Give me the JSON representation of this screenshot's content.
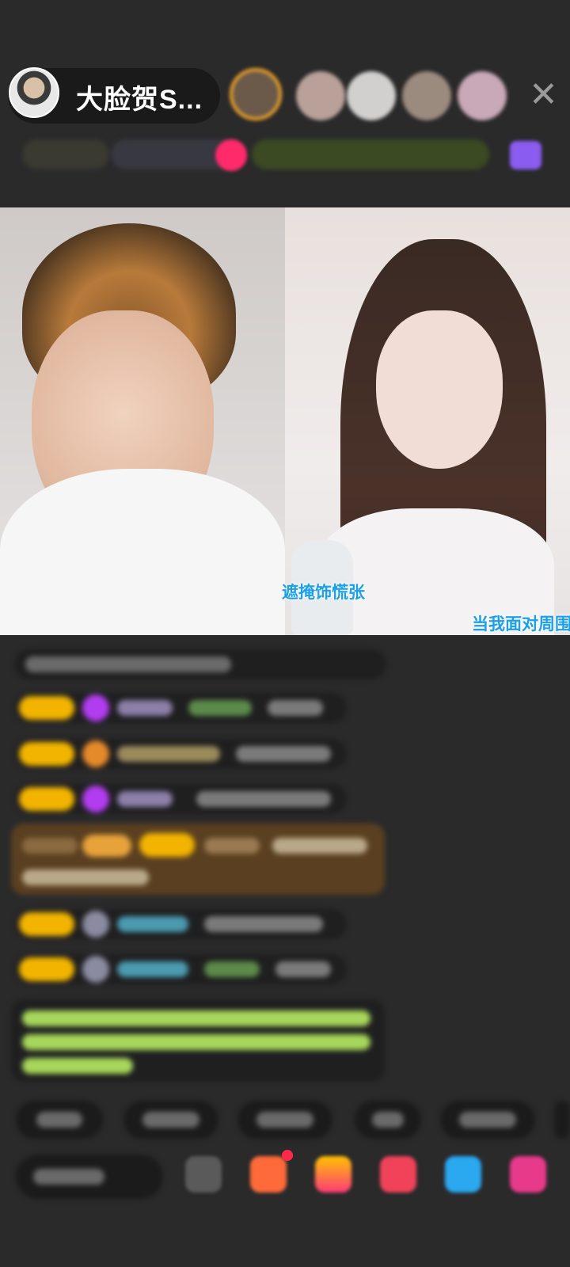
{
  "header": {
    "host_name": "大脸贺S..."
  },
  "video": {
    "subtitle_left": "遮掩饰慌张",
    "subtitle_right": "当我面对周围"
  },
  "colors": {
    "background": "#2a2a2b",
    "pill": "#1a1a1b",
    "badge_gold": "#f2b400",
    "subtitle_blue": "#1aa0e8",
    "chat_green": "#a6d75a"
  },
  "icons": {
    "close": "close-icon"
  }
}
